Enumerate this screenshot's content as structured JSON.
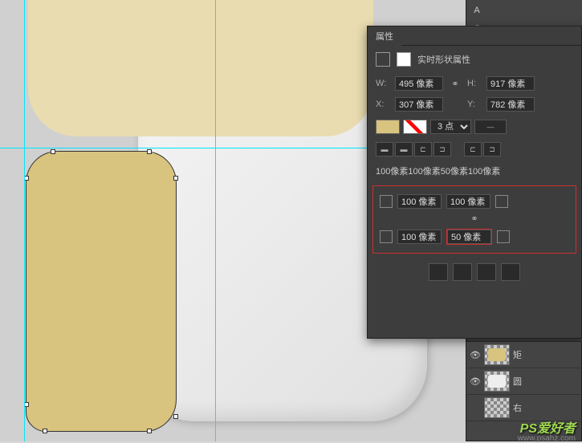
{
  "panel": {
    "title": "属性",
    "live_shape": "实时形状属性",
    "w_label": "W:",
    "h_label": "H:",
    "x_label": "X:",
    "y_label": "Y:",
    "w_value": "495 像素",
    "h_value": "917 像素",
    "x_value": "307 像素",
    "y_value": "782 像素",
    "stroke_size": "3 点",
    "corner_summary": "100像素100像素50像素100像素",
    "corners": {
      "tl": "100 像素",
      "tr": "100 像素",
      "bl": "100 像素",
      "br": "50 像素"
    }
  },
  "layers": {
    "item1": "矩",
    "item2": "圆",
    "item3": "右"
  },
  "watermark": {
    "text": "PS爱好者",
    "url": "www.psahz.com"
  }
}
